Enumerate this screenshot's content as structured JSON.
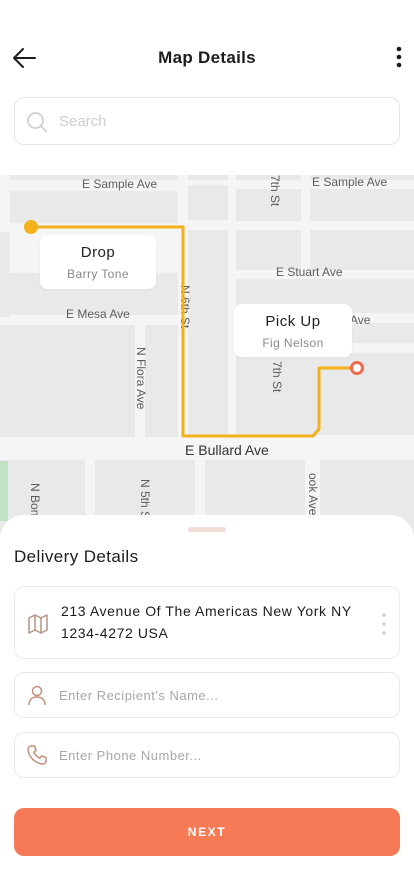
{
  "header": {
    "title": "Map Details",
    "back_icon": "arrow-left-icon",
    "more_icon": "more-vertical-icon"
  },
  "search": {
    "placeholder": "Search",
    "value": ""
  },
  "map": {
    "streets": {
      "sample_ave_left": "E Sample Ave",
      "sample_ave_right": "E Sample Ave",
      "seventh_st_top": "7th St",
      "stuart_ave": "E Stuart Ave",
      "mesa_ave": "E Mesa Ave",
      "sixth_st": "N 6th St",
      "flora_ave": "N Flora Ave",
      "seventh_st": "N 7th St",
      "ave_fragment": "Ave",
      "bullard_ave": "E Bullard Ave",
      "bon_fragment": "N Bon",
      "fifth_st": "N 5th St",
      "ook_ave": "ook Ave"
    },
    "drop": {
      "title": "Drop",
      "name": "Barry Tone"
    },
    "pickup": {
      "title": "Pick Up",
      "name": "Fig Nelson"
    },
    "colors": {
      "route": "#f2b11d",
      "drop_marker": "#f2b11d",
      "pickup_marker": "#f06a4f"
    }
  },
  "sheet": {
    "title": "Delivery Details",
    "address": "213 Avenue Of The Americas New York NY 1234-4272 USA",
    "address_icon": "map-icon",
    "recipient_placeholder": "Enter Recipient's Name...",
    "recipient_icon": "user-icon",
    "phone_placeholder": "Enter Phone Number...",
    "phone_icon": "phone-icon",
    "next_label": "NEXT",
    "accent": "#f57a55"
  }
}
